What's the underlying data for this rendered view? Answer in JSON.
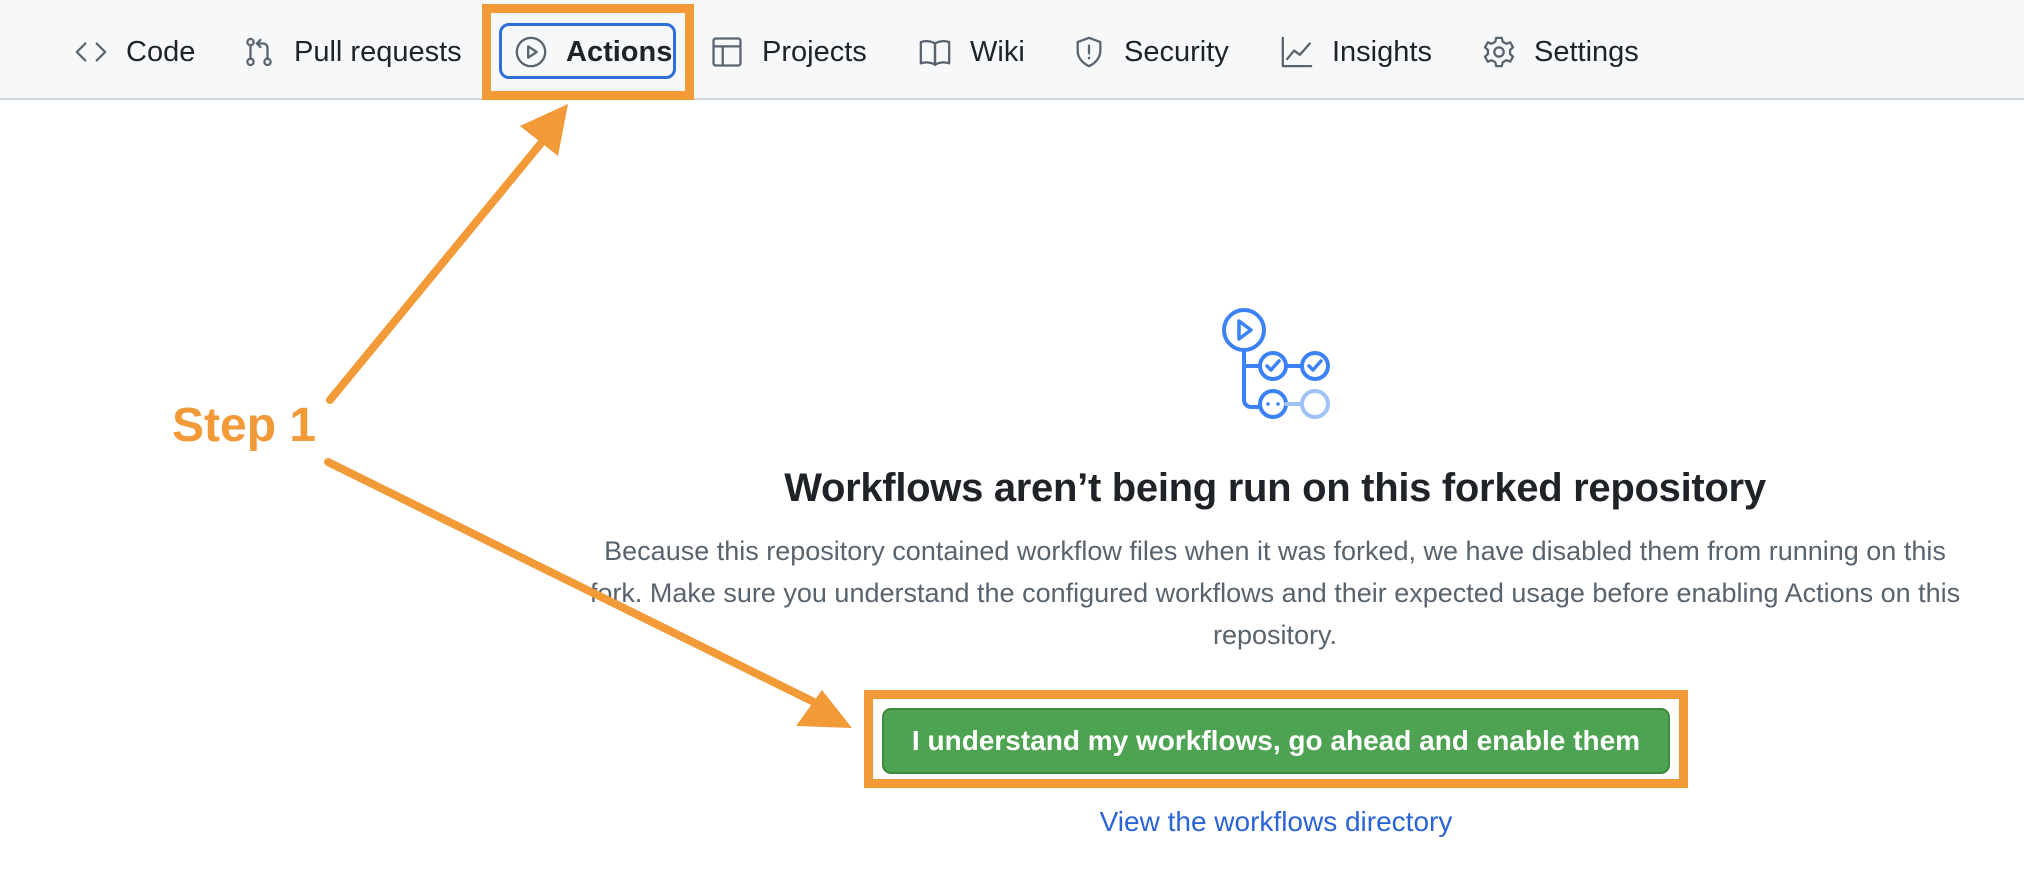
{
  "nav": {
    "tabs": [
      {
        "label": "Code",
        "icon": "code-icon"
      },
      {
        "label": "Pull requests",
        "icon": "pull-request-icon"
      },
      {
        "label": "Actions",
        "icon": "play-icon",
        "selected": true
      },
      {
        "label": "Projects",
        "icon": "table-icon"
      },
      {
        "label": "Wiki",
        "icon": "book-icon"
      },
      {
        "label": "Security",
        "icon": "shield-icon"
      },
      {
        "label": "Insights",
        "icon": "graph-icon"
      },
      {
        "label": "Settings",
        "icon": "gear-icon"
      }
    ]
  },
  "main": {
    "hero_icon": "workflow-icon",
    "heading": "Workflows aren’t being run on this forked repository",
    "description": "Because this repository contained workflow files when it was forked, we have disabled them from running on this fork. Make sure you understand the configured workflows and their expected usage before enabling Actions on this repository.",
    "enable_button": "I understand my workflows, go ahead and enable them",
    "directory_link": "View the workflows directory"
  },
  "annotation": {
    "step_label": "Step 1"
  },
  "colors": {
    "annotation": "#f29a38",
    "button_green": "#4ea352",
    "link_blue": "#2a64d6",
    "icon_blue": "#3b82f6",
    "selected_outline": "#2f6fd8"
  }
}
